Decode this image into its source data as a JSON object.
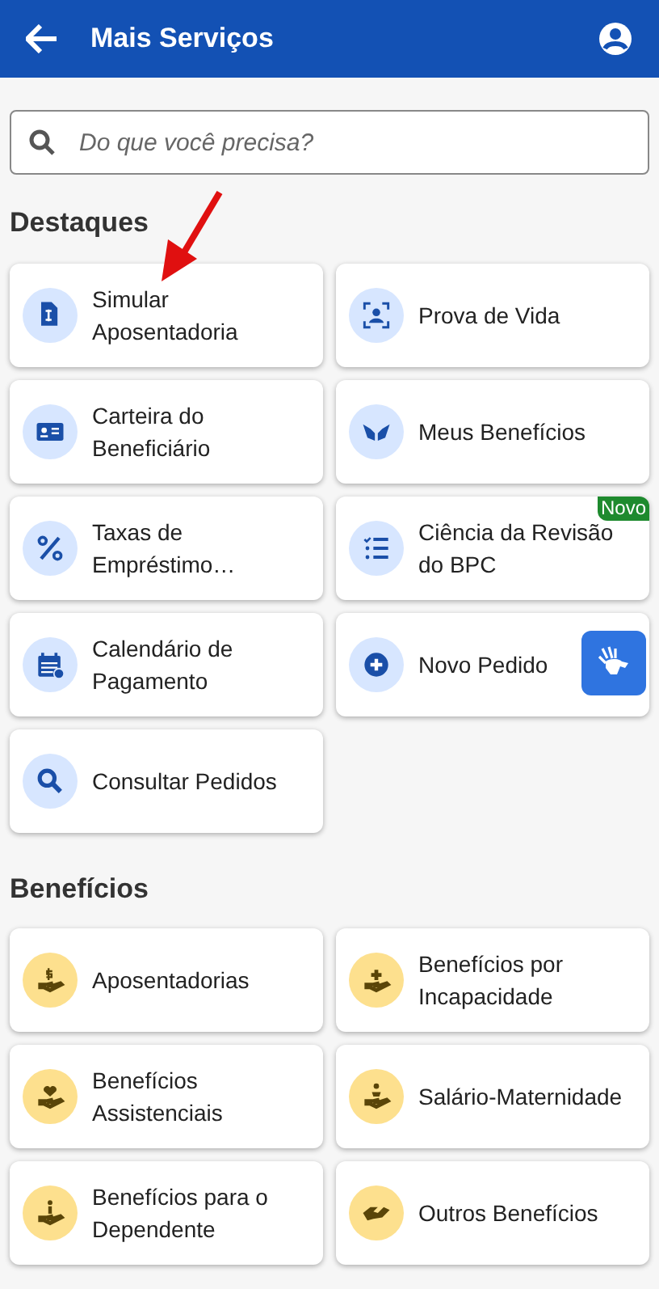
{
  "header": {
    "title": "Mais Serviços"
  },
  "search": {
    "placeholder": "Do que você precisa?"
  },
  "sections": [
    {
      "title": "Destaques",
      "items": [
        {
          "label": "Simular Aposentadoria"
        },
        {
          "label": "Prova de Vida"
        },
        {
          "label": "Carteira do Beneficiário"
        },
        {
          "label": "Meus Benefícios"
        },
        {
          "label": "Taxas de Empréstimo…"
        },
        {
          "label": "Ciência da Revisão do BPC",
          "badge": "Novo"
        },
        {
          "label": "Calendário de Pagamento"
        },
        {
          "label": "Novo Pedido"
        },
        {
          "label": "Consultar Pedidos"
        }
      ]
    },
    {
      "title": "Benefícios",
      "items": [
        {
          "label": "Aposentadorias"
        },
        {
          "label": "Benefícios por Incapacidade"
        },
        {
          "label": "Benefícios Assistenciais"
        },
        {
          "label": "Salário-Maternidade"
        },
        {
          "label": "Benefícios para o Dependente"
        },
        {
          "label": "Outros Benefícios"
        }
      ]
    }
  ]
}
